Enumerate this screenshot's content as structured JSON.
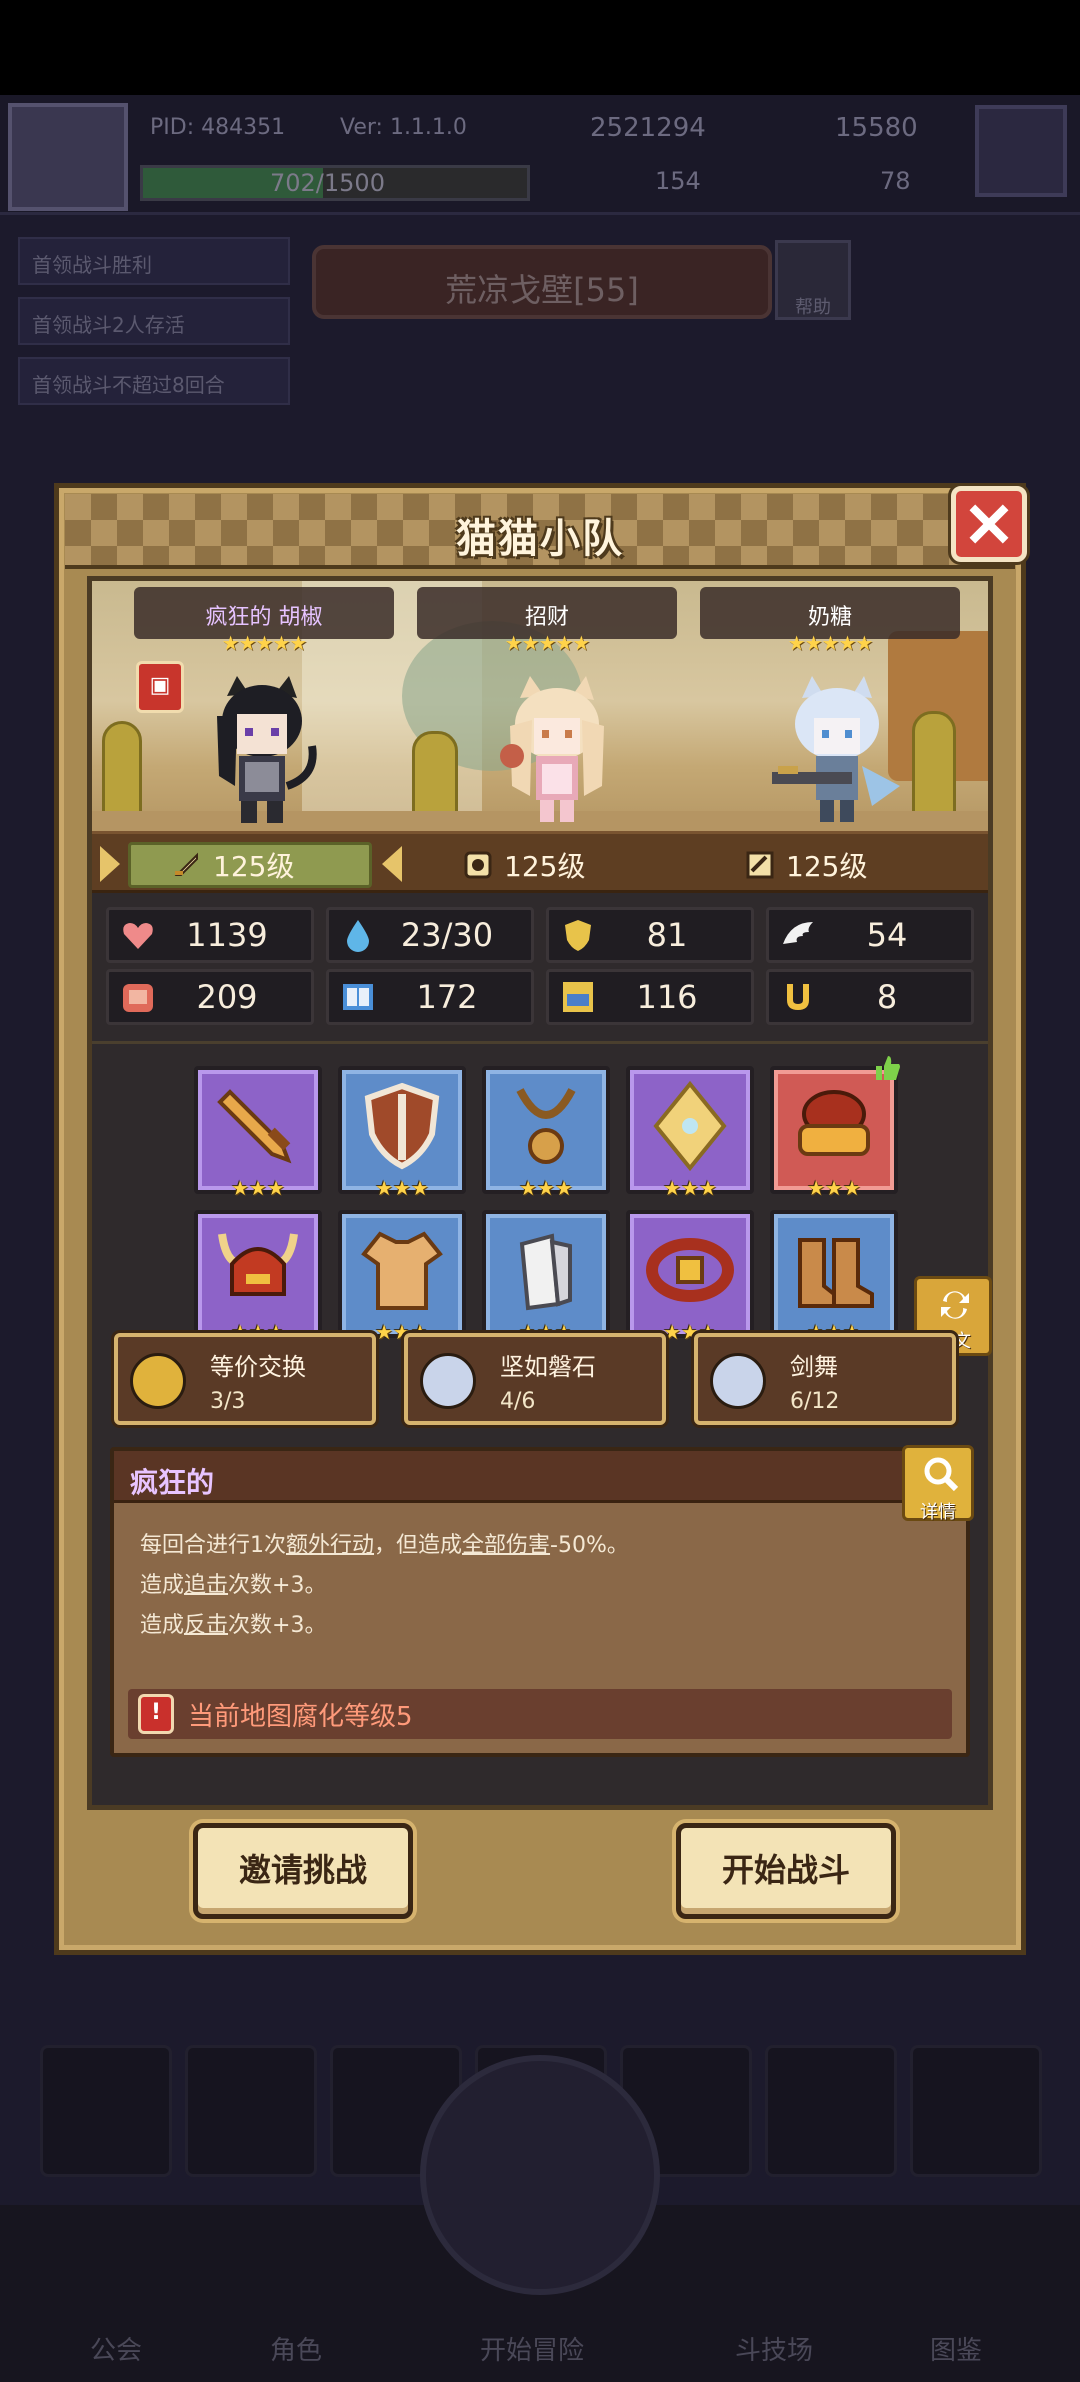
{
  "background": {
    "pid": "PID: 484351",
    "version": "Ver: 1.1.1.0",
    "coins": "2521294",
    "gems": "15580",
    "xp": "702/1500",
    "xp_fraction": 0.468,
    "stat_a": "154",
    "stat_b": "78",
    "quests": [
      "首领战斗胜利",
      "首领战斗2人存活",
      "首领战斗不超过8回合"
    ],
    "stage": "荒凉戈壁[55]",
    "help_label": "帮助",
    "nav": [
      "公会",
      "角色",
      "开始冒险",
      "斗技场",
      "图鉴"
    ]
  },
  "modal": {
    "title": "猫猫小队",
    "characters": [
      {
        "name": "疯狂的 胡椒",
        "stars": "★★★★★",
        "level": "125级"
      },
      {
        "name": "招财",
        "stars": "★★★★★",
        "level": "125级"
      },
      {
        "name": "奶糖",
        "stars": "★★★★★",
        "level": "125级"
      }
    ],
    "stats": {
      "hp": "1139",
      "mana": "23/30",
      "defense": "81",
      "speed": "54",
      "attack": "209",
      "magic": "172",
      "block": "116",
      "luck": "8"
    },
    "equipment_stars": "★★★",
    "rune_label": "符文",
    "sets": [
      {
        "name": "等价交换",
        "count": "3/3"
      },
      {
        "name": "坚如磐石",
        "count": "4/6"
      },
      {
        "name": "剑舞",
        "count": "6/12"
      }
    ],
    "trait": {
      "title": "疯狂的",
      "detail_label": "详情",
      "line1_a": "每回合进行1次",
      "line1_b": "额外行动",
      "line1_c": "，但造成",
      "line1_d": "全部伤害",
      "line1_e": "-50%。",
      "line2_a": "造成",
      "line2_b": "追击",
      "line2_c": "次数+3。",
      "line3_a": "造成",
      "line3_b": "反击",
      "line3_c": "次数+3。",
      "warning": "当前地图腐化等级5"
    },
    "buttons": {
      "invite": "邀请挑战",
      "start": "开始战斗"
    }
  },
  "colors": {
    "modal_frame": "#a88a52",
    "inner_bg": "#2f2a2c",
    "close_red": "#d2453c",
    "star_gold": "#ffd34a",
    "purple_tile": "#8d63c8",
    "blue_tile": "#5e8cc9",
    "red_tile": "#d05a55"
  }
}
